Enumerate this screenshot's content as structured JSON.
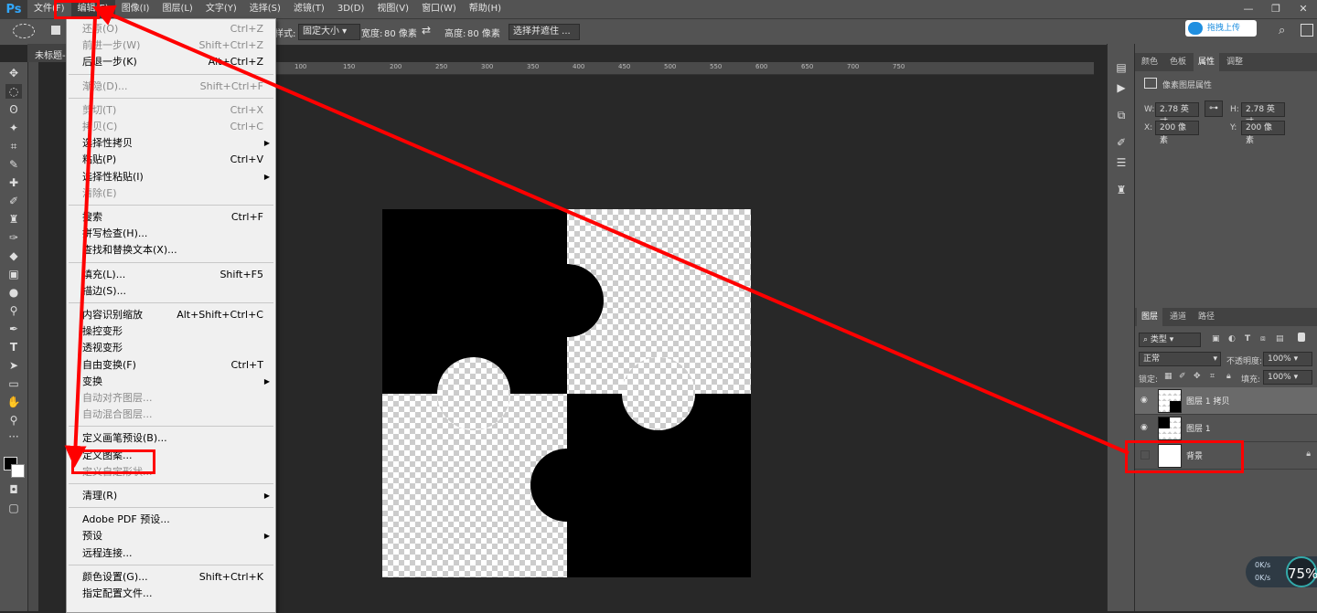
{
  "app": {
    "logo": "Ps"
  },
  "menubar": {
    "items": [
      "文件(F)",
      "编辑(E)",
      "图像(I)",
      "图层(L)",
      "文字(Y)",
      "选择(S)",
      "滤镜(T)",
      "3D(D)",
      "视图(V)",
      "窗口(W)",
      "帮助(H)"
    ]
  },
  "window_controls": {
    "minimize": "—",
    "restore": "❐",
    "close": "✕"
  },
  "options_bar": {
    "style_label": "样式:",
    "style_value": "固定大小",
    "width_label": "宽度:",
    "width_value": "80 像素",
    "height_label": "高度:",
    "height_value": "80 像素",
    "select_mask_button": "选择并遮住 ...",
    "upload_button": "拖拽上传"
  },
  "document": {
    "tab_title": "未标题-"
  },
  "ruler": {
    "h_ticks": [
      "100",
      "150",
      "200",
      "250",
      "300",
      "350",
      "400",
      "450",
      "500",
      "550",
      "600",
      "650",
      "700",
      "750"
    ]
  },
  "edit_menu": {
    "items": [
      {
        "label": "还原(O)",
        "shortcut": "Ctrl+Z",
        "disabled": true
      },
      {
        "label": "前进一步(W)",
        "shortcut": "Shift+Ctrl+Z",
        "disabled": true
      },
      {
        "label": "后退一步(K)",
        "shortcut": "Alt+Ctrl+Z",
        "disabled": false
      },
      {
        "sep": true
      },
      {
        "label": "渐隐(D)...",
        "shortcut": "Shift+Ctrl+F",
        "disabled": true
      },
      {
        "sep": true
      },
      {
        "label": "剪切(T)",
        "shortcut": "Ctrl+X",
        "disabled": true
      },
      {
        "label": "拷贝(C)",
        "shortcut": "Ctrl+C",
        "disabled": true
      },
      {
        "label": "选择性拷贝",
        "shortcut": "",
        "disabled": false,
        "submenu": true
      },
      {
        "label": "粘贴(P)",
        "shortcut": "Ctrl+V",
        "disabled": false
      },
      {
        "label": "选择性粘贴(I)",
        "shortcut": "",
        "disabled": false,
        "submenu": true
      },
      {
        "label": "清除(E)",
        "shortcut": "",
        "disabled": true
      },
      {
        "sep": true
      },
      {
        "label": "搜索",
        "shortcut": "Ctrl+F",
        "disabled": false
      },
      {
        "label": "拼写检查(H)...",
        "shortcut": "",
        "disabled": false
      },
      {
        "label": "查找和替换文本(X)...",
        "shortcut": "",
        "disabled": false
      },
      {
        "sep": true
      },
      {
        "label": "填充(L)...",
        "shortcut": "Shift+F5",
        "disabled": false
      },
      {
        "label": "描边(S)...",
        "shortcut": "",
        "disabled": false
      },
      {
        "sep": true
      },
      {
        "label": "内容识别缩放",
        "shortcut": "Alt+Shift+Ctrl+C",
        "disabled": false
      },
      {
        "label": "操控变形",
        "shortcut": "",
        "disabled": false
      },
      {
        "label": "透视变形",
        "shortcut": "",
        "disabled": false
      },
      {
        "label": "自由变换(F)",
        "shortcut": "Ctrl+T",
        "disabled": false
      },
      {
        "label": "变换",
        "shortcut": "",
        "disabled": false,
        "submenu": true
      },
      {
        "label": "自动对齐图层...",
        "shortcut": "",
        "disabled": true
      },
      {
        "label": "自动混合图层...",
        "shortcut": "",
        "disabled": true
      },
      {
        "sep": true
      },
      {
        "label": "定义画笔预设(B)...",
        "shortcut": "",
        "disabled": false
      },
      {
        "label": "定义图案...",
        "shortcut": "",
        "disabled": false
      },
      {
        "label": "定义自定形状...",
        "shortcut": "",
        "disabled": true
      },
      {
        "sep": true
      },
      {
        "label": "清理(R)",
        "shortcut": "",
        "disabled": false,
        "submenu": true
      },
      {
        "sep": true
      },
      {
        "label": "Adobe PDF 预设...",
        "shortcut": "",
        "disabled": false
      },
      {
        "label": "预设",
        "shortcut": "",
        "disabled": false,
        "submenu": true
      },
      {
        "label": "远程连接...",
        "shortcut": "",
        "disabled": false
      },
      {
        "sep": true
      },
      {
        "label": "颜色设置(G)...",
        "shortcut": "Shift+Ctrl+K",
        "disabled": false
      },
      {
        "label": "指定配置文件...",
        "shortcut": "",
        "disabled": false
      }
    ]
  },
  "properties_panel": {
    "tabs": [
      "颜色",
      "色板",
      "属性",
      "调整"
    ],
    "active_tab": "属性",
    "title": "像素图层属性",
    "w_label": "W:",
    "w_value": "2.78 英寸",
    "h_label": "H:",
    "h_value": "2.78 英寸",
    "x_label": "X:",
    "x_value": "200 像素",
    "y_label": "Y:",
    "y_value": "200 像素"
  },
  "layers_panel": {
    "tabs": [
      "图层",
      "通道",
      "路径"
    ],
    "filter_kind": "类型",
    "blend_mode": "正常",
    "opacity_label": "不透明度:",
    "opacity_value": "100%",
    "lock_label": "锁定:",
    "fill_label": "填充:",
    "fill_value": "100%",
    "layers": [
      {
        "name": "图层 1 拷贝",
        "selected": true
      },
      {
        "name": "图层 1",
        "selected": false
      },
      {
        "name": "背景",
        "selected": false,
        "locked": true
      }
    ]
  },
  "net_monitor": {
    "up": "0K/s",
    "down": "0K/s",
    "percent": "75%"
  },
  "colors": {
    "annotation_red": "#ff0000",
    "ps_blue": "#31a8ff"
  }
}
